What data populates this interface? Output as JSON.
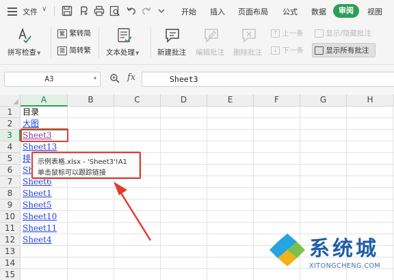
{
  "menubar": {
    "file_label": "文件",
    "tabs": [
      "开始",
      "插入",
      "页面布局",
      "公式",
      "数据",
      "审阅",
      "视图"
    ],
    "active_tab": "审阅",
    "accent_color": "#2e9e57"
  },
  "ribbon": {
    "spell_check": "拼写检查",
    "trad_to_simp": "繁转简",
    "simp_to_trad": "简转繁",
    "text_processing": "文本处理",
    "new_comment": "新建批注",
    "edit_comment": "编辑批注",
    "delete_comment": "删除批注",
    "prev": "上一条",
    "next": "下一条",
    "show_hide_comment": "显示/隐藏批注",
    "show_all_comments": "显示所有批注"
  },
  "formula_bar": {
    "name_box": "A3",
    "fx_label": "fx",
    "formula": "Sheet3"
  },
  "grid": {
    "columns": [
      "A",
      "B",
      "C",
      "D",
      "E",
      "F",
      "G",
      "H"
    ],
    "selected_column": "A",
    "rows": [
      "1",
      "2",
      "3",
      "4",
      "5",
      "6",
      "7",
      "8",
      "9",
      "10",
      "11",
      "12",
      "13",
      "14",
      "15"
    ],
    "selected_row": "3",
    "cells": {
      "a1": "目录",
      "a2": "大图",
      "a3": "Sheet3",
      "a4": "Sheet13",
      "a5": "排",
      "a6": "Sh",
      "a7": "Sheet6",
      "a8": "Sheet1",
      "a9": "Sheet5",
      "a10": "Sheet10",
      "a11": "Sheet11",
      "a12": "Sheet4"
    }
  },
  "tooltip": {
    "line1": "示例表格.xlsx - 'Sheet3'!A1",
    "line2": "单击鼠标可以跟踪链接"
  },
  "annotation_color": "#e23b2e",
  "watermark": {
    "brand": "系统城",
    "url": "XITONGCHENG.COM"
  }
}
